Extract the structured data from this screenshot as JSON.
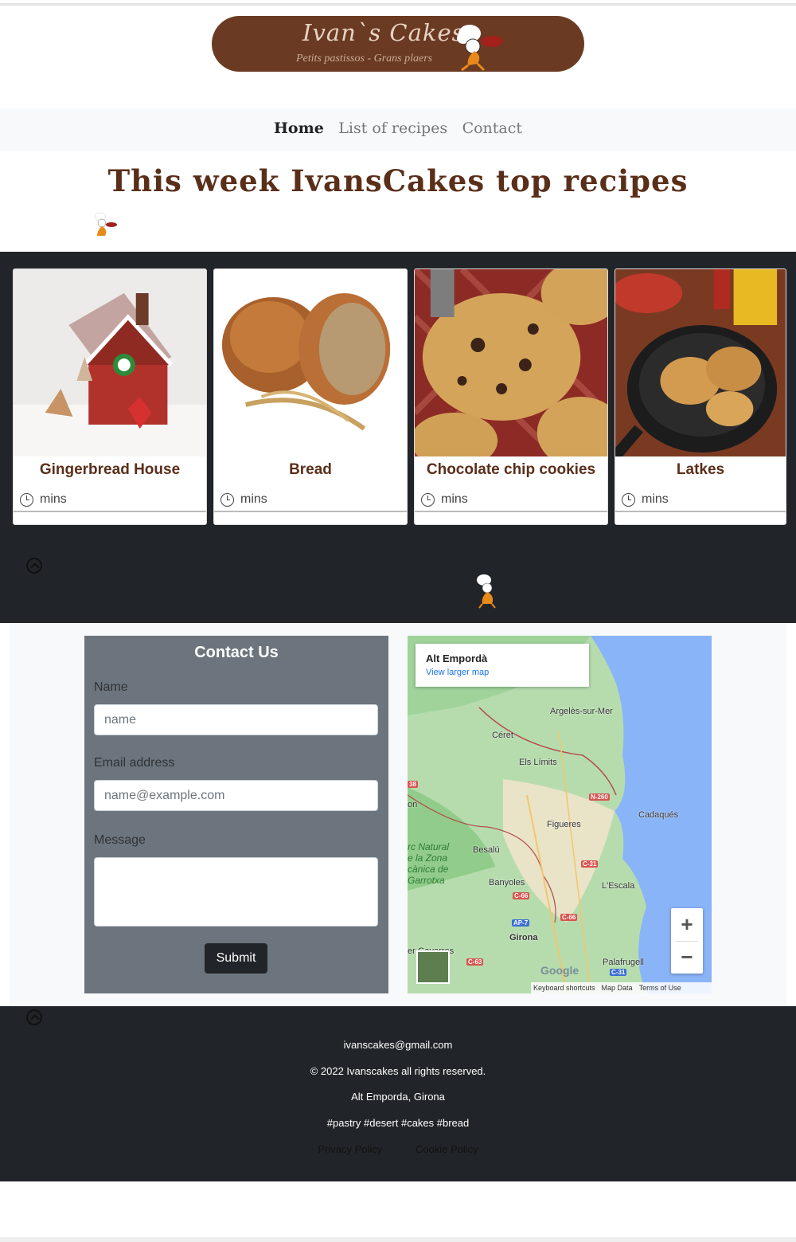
{
  "logo": {
    "title": "Ivan`s Cakes",
    "subtitle": "Petits pastissos - Grans plaers"
  },
  "nav": {
    "items": [
      {
        "label": "Home",
        "active": true
      },
      {
        "label": "List of recipes",
        "active": false
      },
      {
        "label": "Contact",
        "active": false
      }
    ]
  },
  "page_title": "This week IvansCakes top recipes",
  "recipes": [
    {
      "title": "Gingerbread House",
      "time": "mins"
    },
    {
      "title": "Bread",
      "time": "mins"
    },
    {
      "title": "Chocolate chip cookies",
      "time": "mins"
    },
    {
      "title": "Latkes",
      "time": "mins"
    }
  ],
  "contact_form": {
    "title": "Contact Us",
    "name_label": "Name",
    "name_placeholder": "name",
    "email_label": "Email address",
    "email_placeholder": "name@example.com",
    "message_label": "Message",
    "submit_label": "Submit"
  },
  "map": {
    "place_title": "Alt Empordà",
    "link": "View larger map",
    "places": [
      "Argelès-sur-Mer",
      "Céret",
      "Els Límits",
      "Cadaqués",
      "Figueres",
      "Besalú",
      "Banyoles",
      "L'Escala",
      "Girona",
      "Palafrugell",
      "on"
    ],
    "park": "rc Natural\ne la Zona\ncànica de\nGarrotxa",
    "roads": [
      "N-260",
      "C-31",
      "C-66",
      "C-66",
      "AP-7",
      "C-63",
      "C-31",
      "38"
    ],
    "zoom_in": "+",
    "zoom_out": "−",
    "fragment": "er Gavarres",
    "google": "Google",
    "footer": [
      "Keyboard shortcuts",
      "Map Data",
      "Terms of Use"
    ]
  },
  "footer": {
    "email": "ivanscakes@gmail.com",
    "copyright": "© 2022 Ivanscakes all rights reserved.",
    "location": "Alt Emporda, Girona",
    "tags": "#pastry #desert #cakes #bread",
    "links": [
      "Privacy Policy",
      "Cookie Policy"
    ]
  }
}
